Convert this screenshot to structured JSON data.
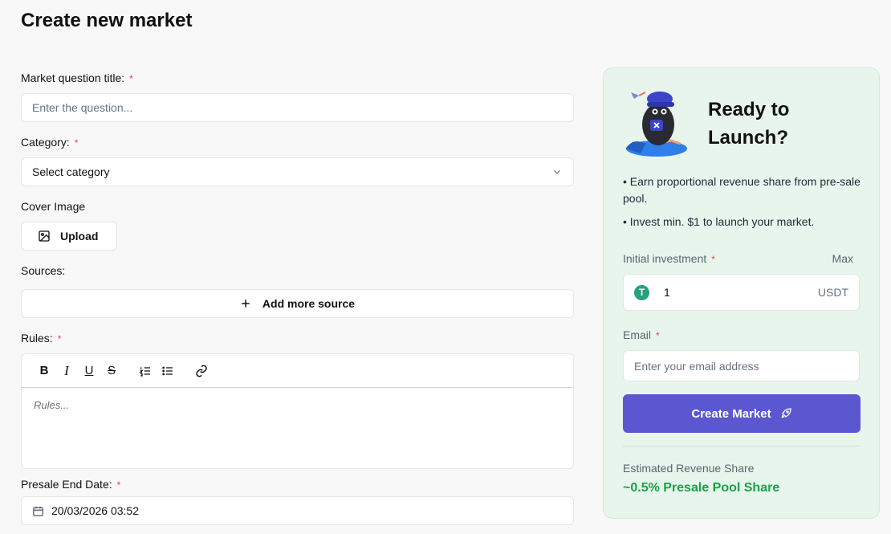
{
  "page": {
    "title": "Create new market"
  },
  "form": {
    "question": {
      "label": "Market question title:",
      "required": "*",
      "placeholder": "Enter the question..."
    },
    "category": {
      "label": "Category:",
      "required": "*",
      "value": "Select category"
    },
    "cover": {
      "label": "Cover Image",
      "button": "Upload"
    },
    "sources": {
      "label": "Sources:",
      "button": "Add more source"
    },
    "rules": {
      "label": "Rules:",
      "required": "*",
      "placeholder": "Rules...",
      "toolbar": [
        "B",
        "I",
        "U",
        "S"
      ]
    },
    "presale": {
      "label": "Presale End Date:",
      "required": "*",
      "value": "20/03/2026 03:52"
    }
  },
  "card": {
    "title": "Ready to Launch?",
    "bullets": [
      "• Earn proportional revenue share from pre-sale pool.",
      "• Invest min. $1 to launch your market."
    ],
    "investment": {
      "label": "Initial investment",
      "required": "*",
      "max": "Max",
      "value": "1",
      "unit": "USDT",
      "icon_letter": "T"
    },
    "email": {
      "label": "Email",
      "required": "*",
      "placeholder": "Enter your email address"
    },
    "create_button": "Create Market",
    "estimate": {
      "label": "Estimated Revenue Share",
      "value": "~0.5% Presale Pool Share"
    }
  },
  "icons": {
    "upload": "image-icon",
    "add": "plus-icon",
    "calendar": "calendar-icon",
    "chevron": "chevron-down-icon",
    "rocket": "rocket-icon"
  },
  "colors": {
    "accent": "#5b57d1",
    "card_bg": "#e8f5ec",
    "success": "#16a34a",
    "required": "#ef4444",
    "tether": "#26a17b"
  }
}
